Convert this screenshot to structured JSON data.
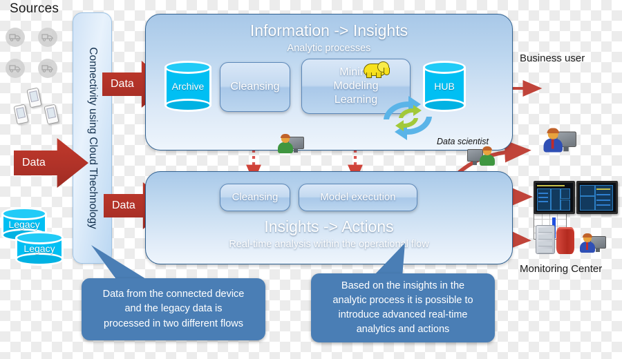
{
  "diagram": {
    "sources": {
      "label": "Sources",
      "device_icons": [
        "truck-icon",
        "truck-icon",
        "truck-icon",
        "truck-icon",
        "mobile-device-icon",
        "mobile-device-icon",
        "mobile-device-icon"
      ],
      "legacy_stores": [
        "Legacy",
        "Legacy"
      ]
    },
    "connectivity": {
      "label": "Connectivity using Cloud Thechnology"
    },
    "flow_arrows": {
      "sources_to_connectivity": "Data",
      "connectivity_to_top_panel": "Data",
      "connectivity_to_bottom_panel": "Data"
    },
    "top_panel": {
      "title": "Information -> Insights",
      "subtitle": "Analytic processes",
      "archive_store": "Archive",
      "cleansing_box": "Cleansing",
      "mining_box_lines": [
        "Mining",
        "Modeling",
        "Learning"
      ],
      "hadoop_icon": "elephant-icon",
      "hub_store": "HUB",
      "cycle_icon": "refresh-cycle-icon",
      "data_scientist_label": "Data scientist",
      "analyst_icon": "person-at-computer-icon"
    },
    "bottom_panel": {
      "title": "Insights -> Actions",
      "subtitle": "Real-time analysis within the operational flow",
      "cleansing_box": "Cleansing",
      "model_execution_box": "Model execution"
    },
    "outputs": [
      {
        "label": "Business user",
        "icon": "person-at-computer-icon"
      },
      {
        "label": "",
        "icon": "bar-chart-icon"
      },
      {
        "label": "",
        "icon": "dual-dashboard-monitors-icon"
      },
      {
        "label": "Monitoring Center",
        "icon": "server-and-operator-icon"
      }
    ],
    "callouts": [
      {
        "name": "left-callout",
        "lines": [
          "Data from the connected device",
          "and the legacy data is",
          "processed in two different flows"
        ]
      },
      {
        "name": "right-callout",
        "lines": [
          "Based on the insights in the",
          "analytic process it is possible to",
          "introduce advanced real-time",
          "analytics and actions"
        ]
      }
    ],
    "colors": {
      "accent_red": "#b03228",
      "cyan_store": "#00bff3",
      "panel_border": "#2e5f8f",
      "callout_blue": "#4a7eb5",
      "hadoop_yellow": "#f7e11e"
    }
  }
}
